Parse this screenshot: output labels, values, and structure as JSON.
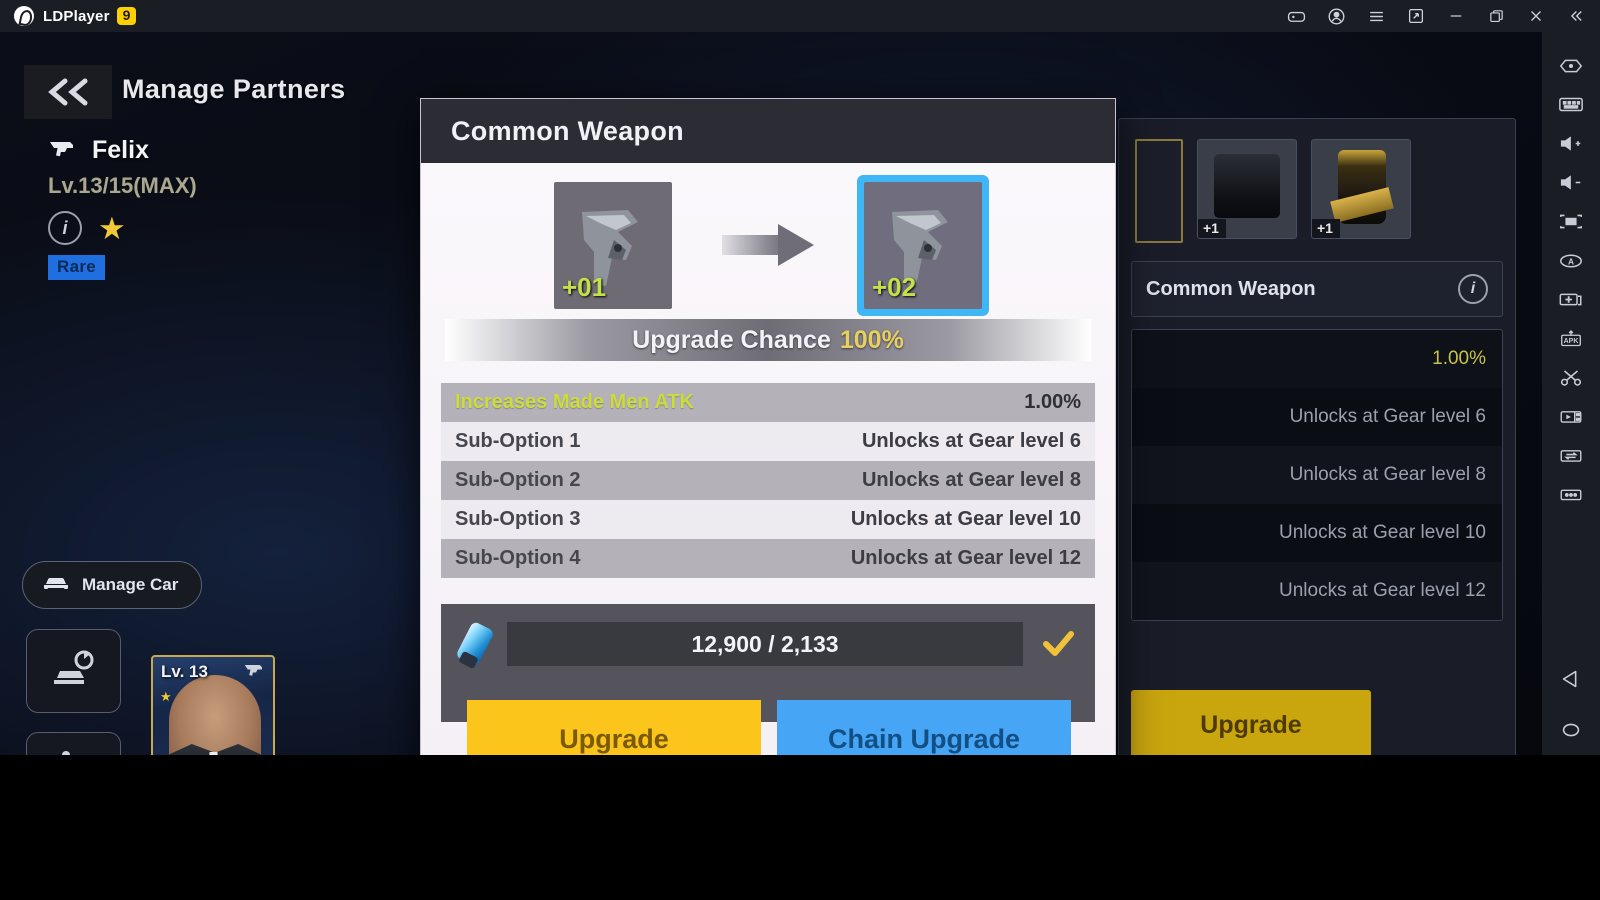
{
  "emulator": {
    "brand": "LDPlayer",
    "badge": "9",
    "titlebar_icons": [
      {
        "name": "gamepad-icon",
        "label": "Game Center"
      },
      {
        "name": "account-icon",
        "label": "Account"
      },
      {
        "name": "menu-icon",
        "label": "Menu"
      },
      {
        "name": "new-window-icon",
        "label": "New Window"
      },
      {
        "name": "minimize-icon",
        "label": "Minimize"
      },
      {
        "name": "maximize-icon",
        "label": "Maximize"
      },
      {
        "name": "close-icon",
        "label": "Close"
      },
      {
        "name": "collapse-icon",
        "label": "Collapse"
      }
    ],
    "sidebar_icons": [
      {
        "name": "eye-icon",
        "label": "Operation Recorder"
      },
      {
        "name": "keyboard-icon",
        "label": "Keyboard Mapping"
      },
      {
        "name": "volume-up-icon",
        "label": "Volume Up"
      },
      {
        "name": "volume-down-icon",
        "label": "Volume Down"
      },
      {
        "name": "fullscreen-icon",
        "label": "Fullscreen"
      },
      {
        "name": "rotate-screen-icon",
        "label": "Rotate Screen"
      },
      {
        "name": "screenshot-icon",
        "label": "Screenshot"
      },
      {
        "name": "install-apk-icon",
        "label": "Install APK"
      },
      {
        "name": "scissors-icon",
        "label": "Cut"
      },
      {
        "name": "video-record-icon",
        "label": "Record"
      },
      {
        "name": "shared-folder-icon",
        "label": "Shared Folder"
      },
      {
        "name": "more-icon",
        "label": "More"
      },
      {
        "name": "back-nav-icon",
        "label": "Back"
      },
      {
        "name": "home-nav-icon",
        "label": "Home"
      }
    ]
  },
  "game": {
    "page_title": "Manage Partners",
    "back_label": "«",
    "character": {
      "name": "Felix",
      "level": "Lv.13/15(MAX)",
      "rarity": "Rare",
      "info_glyph": "i",
      "star_glyph": "★"
    },
    "left_buttons": {
      "manage_car": "Manage Car",
      "car_swap_icon": "car-swap-icon",
      "assign_icon": "assign-partner-icon"
    },
    "partner_card": {
      "level": "Lv. 13"
    },
    "background_panel": {
      "material_slots": [
        {
          "name": "gear-case-item",
          "badge": "+1"
        },
        {
          "name": "supplement-jar-item",
          "badge": "+1"
        }
      ],
      "title": "Common Weapon",
      "info_glyph": "i",
      "options": [
        {
          "label": "Made Men ATK",
          "value": "1.00%"
        },
        {
          "label": "",
          "value": "Unlocks at Gear level 6"
        },
        {
          "label": "",
          "value": "Unlocks at Gear level 8"
        },
        {
          "label": "",
          "value": "Unlocks at Gear level 10"
        },
        {
          "label": "",
          "value": "Unlocks at Gear level 12"
        }
      ],
      "upgrade_button": "Upgrade"
    }
  },
  "dialog": {
    "title": "Common Weapon",
    "preview": {
      "from_badge": "+01",
      "to_badge": "+02",
      "arrow": "arrow-right-icon"
    },
    "chance": {
      "label": "Upgrade Chance",
      "value": "100%"
    },
    "options": [
      {
        "key": "Increases Made Men ATK",
        "value": "1.00%",
        "highlight": true
      },
      {
        "key": "Sub-Option 1",
        "value": "Unlocks at Gear level 6",
        "highlight": false
      },
      {
        "key": "Sub-Option 2",
        "value": "Unlocks at Gear level 8",
        "highlight": false
      },
      {
        "key": "Sub-Option 3",
        "value": "Unlocks at Gear level 10",
        "highlight": false
      },
      {
        "key": "Sub-Option 4",
        "value": "Unlocks at Gear level 12",
        "highlight": false
      }
    ],
    "cost": {
      "token_icon": "weapon-token-icon",
      "amount": "12,900 / 2,133",
      "check_icon": "checkmark-icon"
    },
    "buttons": {
      "upgrade": "Upgrade",
      "chain_upgrade": "Chain Upgrade"
    }
  },
  "colors": {
    "accent_yellow": "#fcc51c",
    "accent_blue": "#46a6f5",
    "highlight_green": "#cddc39",
    "chance_value": "#e8cf5e",
    "rarity_blue": "#1f6fe0",
    "ld_badge": "#ffd000"
  }
}
